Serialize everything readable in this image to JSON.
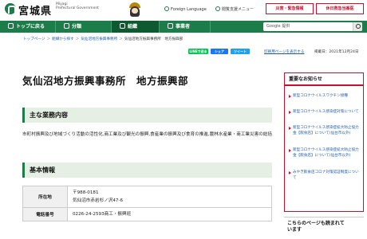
{
  "header": {
    "logo_text": "宮城県",
    "logo_sub_1": "Miyagi",
    "logo_sub_2": "Prefectural Government",
    "foreign_language": "Foreign Language",
    "disaster_support": "閲覧支援メニュー",
    "btn_disaster": "災害・緊急情報",
    "btn_holiday": "休日救急当番医"
  },
  "nav": {
    "items": [
      {
        "label": "トップに戻る",
        "icon": "home-icon"
      },
      {
        "label": "分類",
        "icon": "grid-icon"
      },
      {
        "label": "組織",
        "icon": "org-icon"
      },
      {
        "label": "事業者",
        "icon": "building-icon"
      }
    ],
    "search_placeholder": "Google 提供"
  },
  "breadcrumb": {
    "items": [
      "トップページ",
      "組織から探す",
      "気仙沼地方振興事務所",
      "気仙沼地方振興事務所　地方振興部"
    ]
  },
  "share": {
    "line": "LINEで送る",
    "facebook": "シェア",
    "tweet": "ツイート"
  },
  "print_label": "印刷用ページを表示する",
  "update": "掲載日：2021年12月24日",
  "page_title": "気仙沼地方振興事務所　地方振興部",
  "sections": {
    "duties_title": "主な業務内容",
    "duties_text": "市町村振興及び地域づくり活動の活性化,商工業及び観光の振興,食産業の振興及び食育の推進,農林水産業・商工業災害の総括",
    "basic_title": "基本情報"
  },
  "basic_info": [
    {
      "label": "所在地",
      "lines": [
        "〒988-0181",
        "気仙沼市赤岩杉ノ沢47-6"
      ]
    },
    {
      "label": "電話番号",
      "lines": [
        "0226-24-2593商工・振興班"
      ]
    }
  ],
  "sidebar": {
    "title": "重要なお知らせ",
    "items": [
      "新型コロナウイルスワクチン接種",
      "新型コロナウイルス感染症対策について",
      "新型コロナウイルス感染症拡大防止協力金【飲食店】について(仙台市以外)",
      "新型コロナウイルス感染症拡大防止協力金【飲食店】について(仙台市以外)",
      "みやぎ飲食店コロナ対策認証制度について"
    ],
    "box2_title_1": "こちらのページも読まれて",
    "box2_title_2": "います"
  },
  "colors": {
    "brand_green": "#1c7c4a",
    "alert_red": "#c8102e",
    "section_bg": "#e6efe3"
  }
}
